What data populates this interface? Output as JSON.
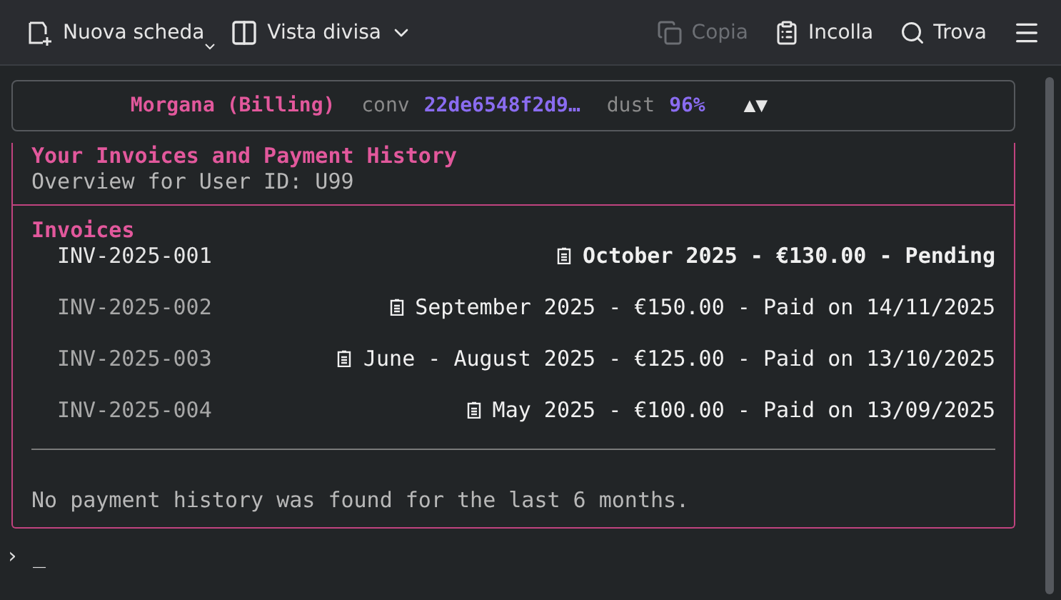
{
  "toolbar": {
    "left": [
      {
        "kind": "new-tab",
        "label": "Nuova scheda",
        "disabled": false
      },
      {
        "kind": "split",
        "label": "Vista divisa",
        "disabled": false
      }
    ],
    "right": [
      {
        "kind": "copy",
        "label": "Copia",
        "disabled": true
      },
      {
        "kind": "paste",
        "label": "Incolla",
        "disabled": false
      },
      {
        "kind": "find",
        "label": "Trova",
        "disabled": false
      }
    ]
  },
  "status": {
    "agent": "Morgana (Billing)",
    "conv_label": "conv",
    "conv_value": "22de6548f2d9…",
    "dust_label": "dust",
    "dust_value": "96%",
    "arrows": "▲▼"
  },
  "panel": {
    "title": "Your Invoices and Payment History",
    "subtitle": "Overview for User ID: U99",
    "section": "Invoices",
    "invoices": [
      {
        "id": "INV-2025-001",
        "detail": "October 2025 - €130.00 - Pending",
        "highlighted": true
      },
      {
        "id": "INV-2025-002",
        "detail": "September 2025 - €150.00 - Paid on 14/11/2025",
        "highlighted": false
      },
      {
        "id": "INV-2025-003",
        "detail": "June - August 2025 - €125.00 - Paid on 13/10/2025",
        "highlighted": false
      },
      {
        "id": "INV-2025-004",
        "detail": "May 2025 - €100.00 - Paid on 13/09/2025",
        "highlighted": false
      }
    ],
    "note": "No payment history was found for the last 6 months."
  },
  "prompt": {
    "marker": "›",
    "cursor": "_"
  }
}
